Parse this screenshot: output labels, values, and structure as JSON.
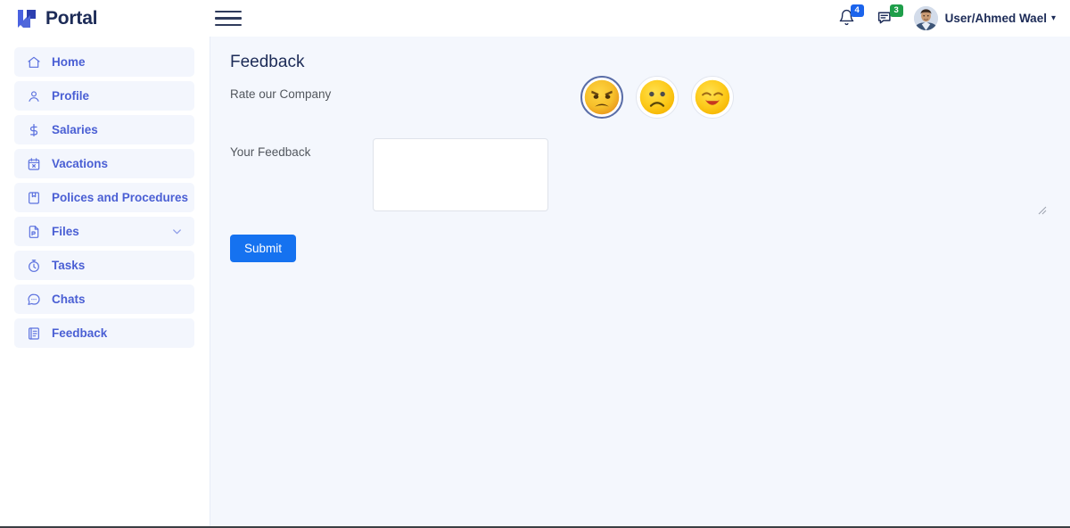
{
  "header": {
    "brand_name": "Portal",
    "brand_logo_icon": "portal-arrow-logo",
    "menu_toggle_icon": "hamburger-menu-icon",
    "notifications": {
      "icon": "bell-icon",
      "count": "4",
      "badge_color": "#1b64ec"
    },
    "messages": {
      "icon": "messages-icon",
      "count": "3",
      "badge_color": "#1e9e4a"
    },
    "user": {
      "avatar_icon": "user-avatar-photo",
      "name": "User/Ahmed Wael",
      "caret_icon": "caret-down-icon"
    }
  },
  "sidebar": {
    "items": [
      {
        "label": "Home",
        "icon": "home-icon",
        "expandable": false
      },
      {
        "label": "Profile",
        "icon": "user-icon",
        "expandable": false
      },
      {
        "label": "Salaries",
        "icon": "dollar-icon",
        "expandable": false
      },
      {
        "label": "Vacations",
        "icon": "calendar-icon",
        "expandable": false
      },
      {
        "label": "Polices and Procedures",
        "icon": "book-icon",
        "expandable": false
      },
      {
        "label": "Files",
        "icon": "file-icon",
        "expandable": true
      },
      {
        "label": "Tasks",
        "icon": "timer-icon",
        "expandable": false
      },
      {
        "label": "Chats",
        "icon": "chat-icon",
        "expandable": false
      },
      {
        "label": "Feedback",
        "icon": "feedback-icon",
        "expandable": false
      }
    ]
  },
  "main": {
    "page_title": "Feedback",
    "rating": {
      "label": "Rate our Company",
      "options": [
        {
          "name": "angry",
          "icon": "angry-face-icon",
          "selected": true
        },
        {
          "name": "sad",
          "icon": "frowning-face-icon",
          "selected": false
        },
        {
          "name": "happy",
          "icon": "smiling-face-icon",
          "selected": false
        }
      ]
    },
    "feedback": {
      "label": "Your Feedback",
      "value": "",
      "placeholder": ""
    },
    "submit_label": "Submit"
  },
  "colors": {
    "brand_navy": "#1c2b57",
    "nav_blue": "#4a5fd4",
    "nav_item_bg": "#f3f6fd",
    "content_bg": "#f4f7fd",
    "submit_blue": "#1572f0"
  }
}
